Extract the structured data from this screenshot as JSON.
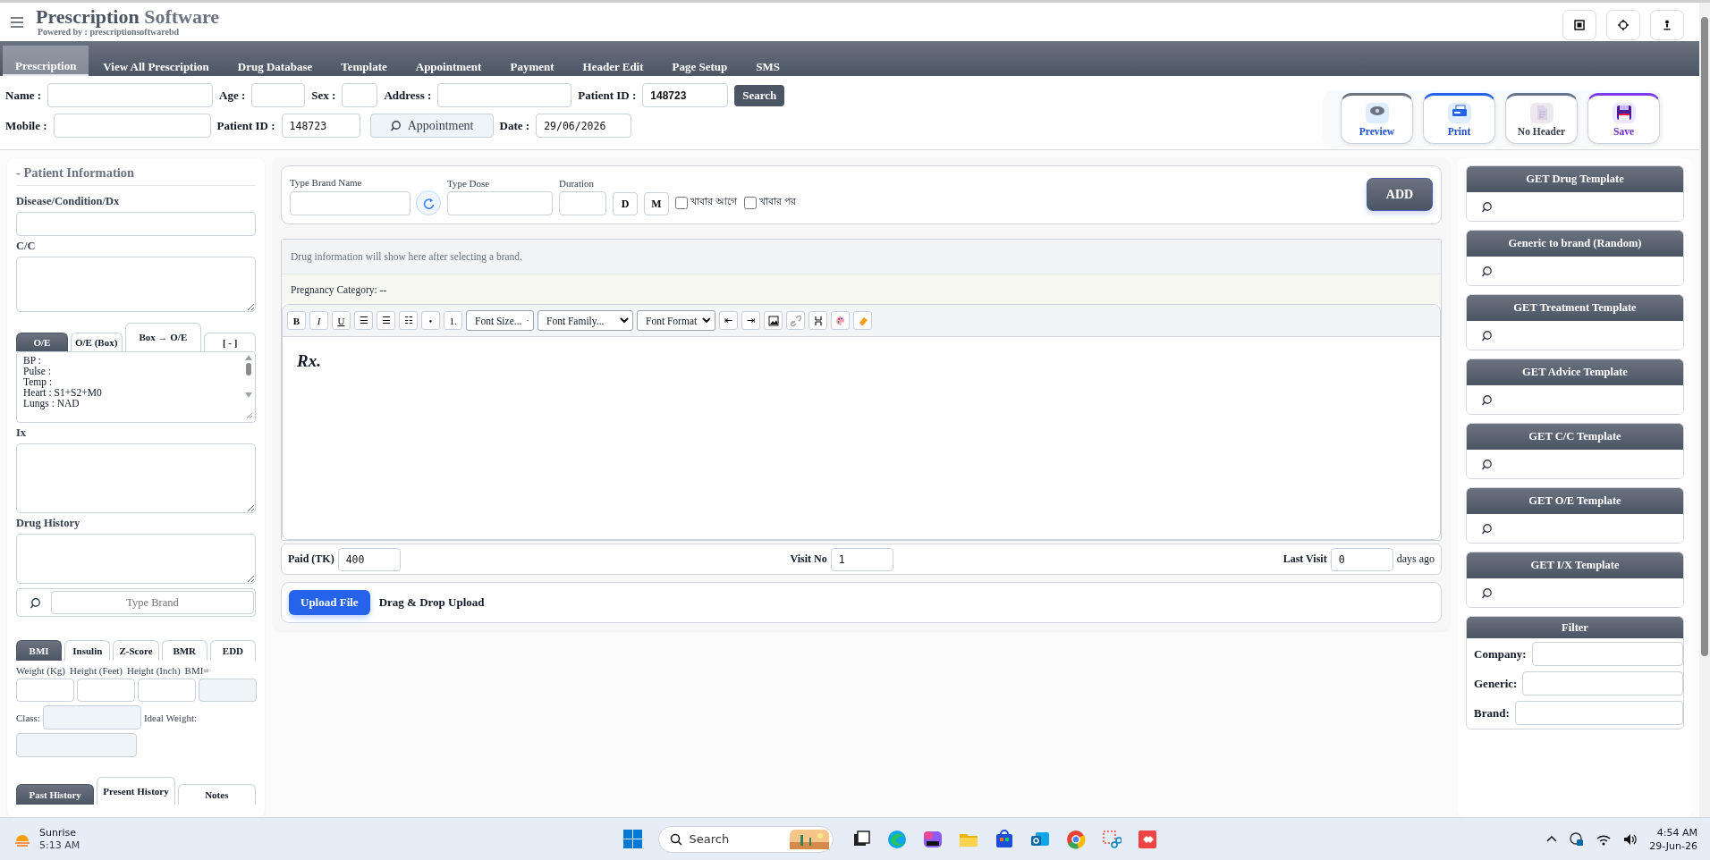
{
  "header": {
    "title": "Prescription",
    "title_accent": "Software",
    "powered_by": "Powered by : prescriptionsoftwarebd"
  },
  "nav_tabs": [
    {
      "label": "Prescription",
      "selected": true
    },
    {
      "label": "View All Prescription",
      "selected": false
    },
    {
      "label": "Drug Database",
      "selected": false
    },
    {
      "label": "Template",
      "selected": false
    },
    {
      "label": "Appointment",
      "selected": false
    },
    {
      "label": "Payment",
      "selected": false
    },
    {
      "label": "Header Edit",
      "selected": false
    },
    {
      "label": "Page Setup",
      "selected": false
    },
    {
      "label": "SMS",
      "selected": false
    }
  ],
  "patient_form": {
    "name": {
      "label": "Name :"
    },
    "age": {
      "label": "Age :"
    },
    "sex": {
      "label": "Sex :"
    },
    "address": {
      "label": "Address :"
    },
    "patient_id": {
      "label": "Patient ID :",
      "value": "148723"
    },
    "search_button": "Search",
    "mobile": {
      "label": "Mobile :"
    },
    "patient_id_2": {
      "label": "Patient ID :",
      "value": "148723"
    },
    "appointment_button": "Appointment",
    "date": {
      "label": "Date :",
      "value": "29/06/2026"
    }
  },
  "actions": [
    {
      "label": "Preview",
      "kind": "preview"
    },
    {
      "label": "Print",
      "kind": "print"
    },
    {
      "label": "No Header",
      "kind": "no_header"
    },
    {
      "label": "Save",
      "kind": "save"
    }
  ],
  "patient_info": {
    "title": "- Patient Information",
    "dx": {
      "label": "Disease/Condition/Dx"
    },
    "cc": {
      "label": "C/C"
    },
    "exam_tabs": [
      {
        "label": "O/E",
        "selected": true
      },
      {
        "label": "O/E (Box)",
        "selected": false
      },
      {
        "label": "Box → O/E",
        "selected": false
      },
      {
        "label": "[ - ]",
        "selected": false
      }
    ],
    "exam_notes": [
      "BP :",
      "Pulse :",
      "Temp :",
      "Heart : S1+S2+M0",
      "Lungs : NAD"
    ],
    "ix": {
      "label": "Ix"
    },
    "drug_history": {
      "label": "Drug History"
    },
    "brand_search": {
      "placeholder": "Type Brand"
    },
    "calc_tabs": [
      {
        "label": "BMI",
        "selected": true
      },
      {
        "label": "Insulin",
        "selected": false
      },
      {
        "label": "Z-Score",
        "selected": false
      },
      {
        "label": "BMR",
        "selected": false
      },
      {
        "label": "EDD",
        "selected": false
      }
    ],
    "calc_labels": [
      "Weight (Kg)",
      "Height (Feet)",
      "Height (Inch)",
      "BMI="
    ],
    "class_label": "Class:",
    "ideal_weight_label": "Ideal Weight:",
    "history_tabs": [
      {
        "label": "Past History",
        "selected": true
      },
      {
        "label": "Present History",
        "selected": false
      },
      {
        "label": "Notes",
        "selected": false
      }
    ]
  },
  "drug_entry": {
    "brand_label": "Type Brand Name",
    "dose_label": "Type Dose",
    "duration_label": "Duration",
    "unit_buttons": [
      "D",
      "M"
    ],
    "meal_options": [
      {
        "label": "খাবার আগে",
        "checked": false
      },
      {
        "label": "খাবার পর",
        "checked": false
      }
    ],
    "add_button": "ADD"
  },
  "drug_info": {
    "message": "Drug information will show here after selecting a brand.",
    "pregnancy": "Pregnancy Category: --"
  },
  "editor": {
    "toolbar": [
      {
        "kind": "bold",
        "label": "B"
      },
      {
        "kind": "italic",
        "label": "I"
      },
      {
        "kind": "underline",
        "label": "U"
      },
      {
        "kind": "glyph",
        "label": "☰"
      },
      {
        "kind": "glyph",
        "label": "☰"
      },
      {
        "kind": "glyph",
        "label": "☷"
      },
      {
        "kind": "glyph",
        "label": "•"
      },
      {
        "kind": "glyph",
        "label": "1."
      },
      {
        "kind": "select",
        "label": "Font Size..."
      },
      {
        "kind": "select",
        "label": "Font Family..."
      },
      {
        "kind": "select",
        "label": "Font Format"
      },
      {
        "kind": "glyph",
        "label": "⇤"
      },
      {
        "kind": "glyph",
        "label": "⇥"
      }
    ],
    "content": "Rx."
  },
  "visit_bar": {
    "paid": {
      "label": "Paid (TK)",
      "value": "400"
    },
    "visit_no": {
      "label": "Visit No",
      "value": "1"
    },
    "last_visit": {
      "label": "Last Visit",
      "value": "0",
      "suffix": "days ago"
    }
  },
  "upload": {
    "button": "Upload File",
    "hint": "Drag & Drop Upload"
  },
  "templates": [
    {
      "title": "GET Drug Template"
    },
    {
      "title": "Generic to brand (Random)"
    },
    {
      "title": "GET Treatment Template"
    },
    {
      "title": "GET Advice Template"
    },
    {
      "title": "GET C/C Template"
    },
    {
      "title": "GET O/E Template"
    },
    {
      "title": "GET I/X Template"
    }
  ],
  "filter": {
    "title": "Filter",
    "fields": [
      {
        "label": "Company:"
      },
      {
        "label": "Generic:"
      },
      {
        "label": "Brand:"
      }
    ]
  },
  "taskbar": {
    "weather": {
      "title": "Sunrise",
      "subtitle": "5:13 AM"
    },
    "search_placeholder": "Search",
    "clock": {
      "time": "4:54 AM",
      "date": "29-Jun-26"
    }
  }
}
